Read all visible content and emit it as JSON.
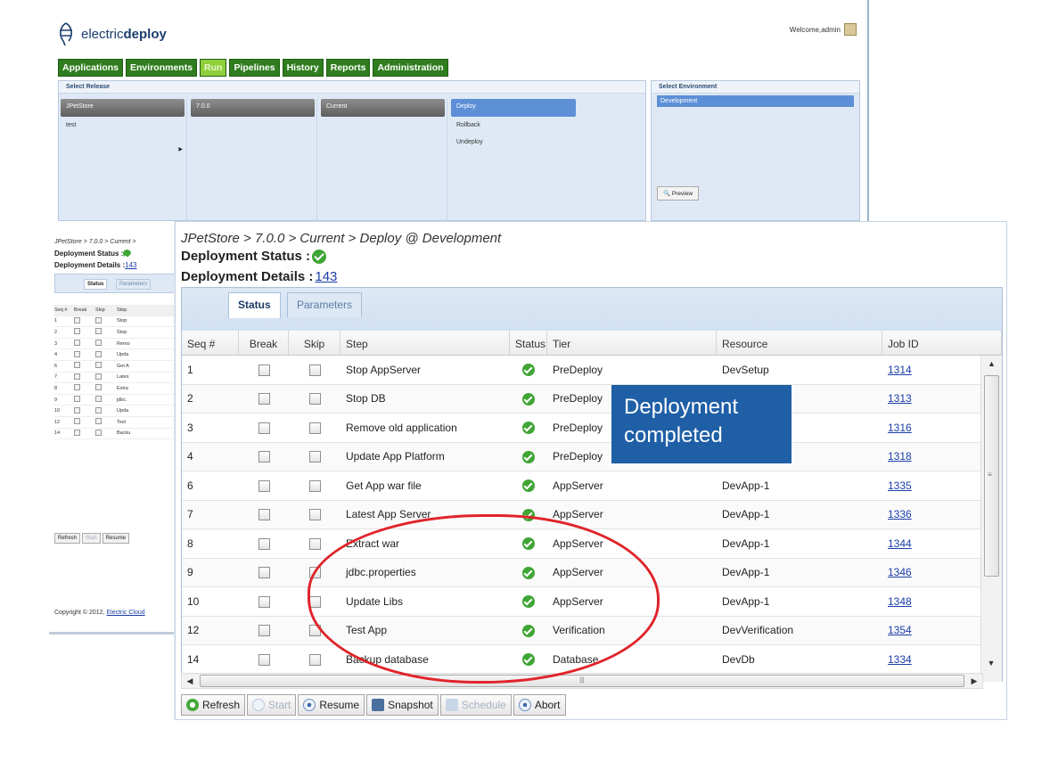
{
  "app": {
    "logo_text_light": "electric",
    "logo_text_bold": "deploy",
    "welcome": "Welcome,admin"
  },
  "nav": [
    "Applications",
    "Environments",
    "Run",
    "Pipelines",
    "History",
    "Reports",
    "Administration"
  ],
  "release_panel": {
    "title": "Select Release",
    "columns": [
      {
        "header": "JPetStore",
        "items": [
          "test"
        ]
      },
      {
        "header": "7.0.0",
        "items": []
      },
      {
        "header": "Current",
        "items": []
      },
      {
        "header": "Deploy",
        "items": [
          "Rollback",
          "Undeploy"
        ]
      }
    ]
  },
  "env_panel": {
    "title": "Select Environment",
    "selected": "Development",
    "preview": "Preview"
  },
  "bg": {
    "breadcrumb": "JPetStore > 7.0.0 > Current >",
    "status_label": "Deployment Status :",
    "details_label": "Deployment Details :",
    "details_id": "143",
    "tabs": [
      "Status",
      "Parameters"
    ],
    "grid_head": [
      "Seq #",
      "Break",
      "Skip",
      "Step"
    ],
    "seq": [
      "1",
      "2",
      "3",
      "4",
      "6",
      "7",
      "8",
      "9",
      "10",
      "12",
      "14"
    ],
    "steps": [
      "Stop",
      "Stop",
      "Remo",
      "Upda",
      "Get A",
      "Lates",
      "Extra",
      "jdbc.",
      "Upda",
      "Test",
      "Backu"
    ],
    "footer": [
      "Refresh",
      "Start",
      "Resume"
    ],
    "copyright": "Copyright © 2012,",
    "copyright_link": "Electric Cloud"
  },
  "main": {
    "breadcrumb": "JPetStore > 7.0.0 > Current > Deploy @ Development",
    "status_label": "Deployment Status :",
    "details_label": "Deployment Details :",
    "details_id": "143",
    "tabs": [
      "Status",
      "Parameters"
    ],
    "columns": [
      "Seq #",
      "Break",
      "Skip",
      "Step",
      "Status",
      "Tier",
      "Resource",
      "Job ID"
    ],
    "rows": [
      {
        "seq": "1",
        "step": "Stop AppServer",
        "tier": "PreDeploy",
        "resource": "DevSetup",
        "job": "1314"
      },
      {
        "seq": "2",
        "step": "Stop DB",
        "tier": "PreDeploy",
        "resource": "",
        "job": "1313"
      },
      {
        "seq": "3",
        "step": "Remove old application",
        "tier": "PreDeploy",
        "resource": "",
        "job": "1316"
      },
      {
        "seq": "4",
        "step": "Update App Platform",
        "tier": "PreDeploy",
        "resource": "",
        "job": "1318"
      },
      {
        "seq": "6",
        "step": "Get App war file",
        "tier": "AppServer",
        "resource": "DevApp-1",
        "job": "1335"
      },
      {
        "seq": "7",
        "step": "Latest App Server",
        "tier": "AppServer",
        "resource": "DevApp-1",
        "job": "1336"
      },
      {
        "seq": "8",
        "step": "Extract war",
        "tier": "AppServer",
        "resource": "DevApp-1",
        "job": "1344"
      },
      {
        "seq": "9",
        "step": "jdbc.properties",
        "tier": "AppServer",
        "resource": "DevApp-1",
        "job": "1346"
      },
      {
        "seq": "10",
        "step": "Update Libs",
        "tier": "AppServer",
        "resource": "DevApp-1",
        "job": "1348"
      },
      {
        "seq": "12",
        "step": "Test App",
        "tier": "Verification",
        "resource": "DevVerification",
        "job": "1354"
      },
      {
        "seq": "14",
        "step": "Backup database",
        "tier": "Database",
        "resource": "DevDb",
        "job": "1334"
      }
    ],
    "toolbar": [
      "Refresh",
      "Start",
      "Resume",
      "Snapshot",
      "Schedule",
      "Abort"
    ],
    "callout": "Deployment completed"
  },
  "colors": {
    "nav_green": "#2f7d1e",
    "nav_active": "#8fcf3c",
    "status_ok": "#3fa535",
    "callout_bg": "#1f5fa6",
    "highlight_oval": "#e0242a",
    "link": "#1b3ea8"
  }
}
